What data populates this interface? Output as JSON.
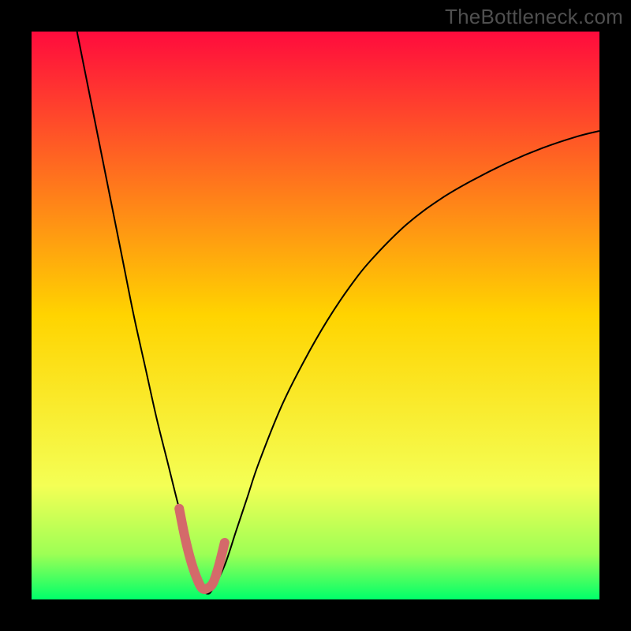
{
  "watermark": "TheBottleneck.com",
  "chart_data": {
    "type": "line",
    "title": "",
    "xlabel": "",
    "ylabel": "",
    "xlim": [
      0,
      100
    ],
    "ylim": [
      0,
      100
    ],
    "grid": false,
    "legend": false,
    "background_gradient": {
      "direction": "top-to-bottom",
      "stops": [
        {
          "offset": 0.0,
          "color": "#ff0b3d"
        },
        {
          "offset": 0.5,
          "color": "#ffd400"
        },
        {
          "offset": 0.8,
          "color": "#f4ff55"
        },
        {
          "offset": 0.92,
          "color": "#9dff55"
        },
        {
          "offset": 1.0,
          "color": "#00ff6a"
        }
      ]
    },
    "series": [
      {
        "name": "curve",
        "color": "#000000",
        "stroke_width": 2,
        "x": [
          8,
          10,
          12,
          14,
          16,
          18,
          20,
          22,
          24,
          26,
          28,
          29,
          30,
          31,
          32,
          34,
          36,
          38,
          40,
          44,
          48,
          52,
          56,
          60,
          66,
          72,
          78,
          84,
          90,
          96,
          100
        ],
        "y": [
          100,
          90,
          80,
          70,
          60,
          50,
          41,
          32,
          24,
          16,
          9,
          5,
          2,
          1,
          2,
          6,
          12,
          18,
          24,
          34,
          42,
          49,
          55,
          60,
          66,
          70.5,
          74,
          77,
          79.5,
          81.5,
          82.5
        ]
      },
      {
        "name": "valley-highlight",
        "color": "#d46a6a",
        "stroke_width": 12,
        "linecap": "round",
        "x": [
          26,
          27,
          28,
          29,
          30,
          31,
          32,
          33,
          34
        ],
        "y": [
          16,
          11,
          7,
          4,
          2,
          2,
          3,
          6,
          10
        ]
      }
    ]
  }
}
